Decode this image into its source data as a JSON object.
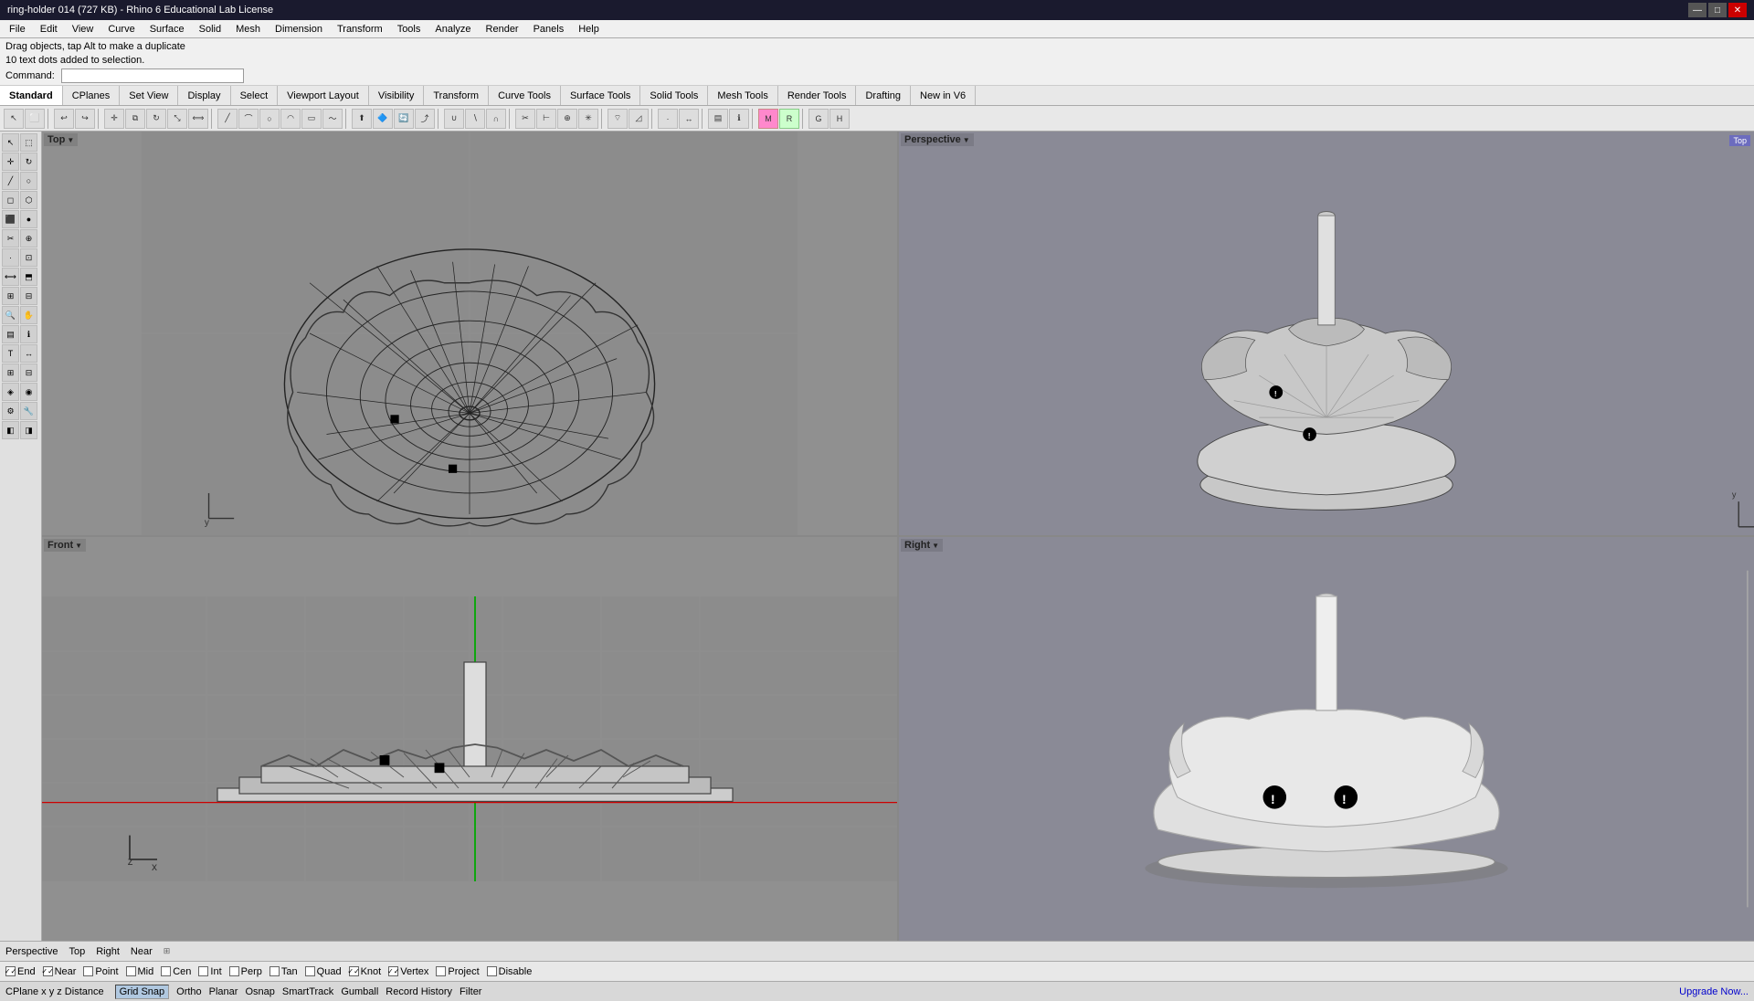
{
  "titleBar": {
    "title": "ring-holder 014 (727 KB) - Rhino 6 Educational Lab License",
    "minimize": "—",
    "maximize": "□",
    "close": "✕"
  },
  "menuBar": {
    "items": [
      "File",
      "Edit",
      "View",
      "Curve",
      "Surface",
      "Solid",
      "Mesh",
      "Dimension",
      "Transform",
      "Tools",
      "Analyze",
      "Render",
      "Panels",
      "Help"
    ]
  },
  "infoBar": {
    "line1": "Drag objects, tap Alt to make a duplicate",
    "line2": "10 text dots added to selection.",
    "commandLabel": "Command:"
  },
  "toolbarTabs": {
    "tabs": [
      "Standard",
      "CPlanes",
      "Set View",
      "Display",
      "Select",
      "Viewport Layout",
      "Visibility",
      "Transform",
      "Curve Tools",
      "Surface Tools",
      "Solid Tools",
      "Mesh Tools",
      "Render Tools",
      "Drafting",
      "New in V6"
    ]
  },
  "viewports": {
    "topLeft": {
      "label": "Top",
      "type": "orthographic"
    },
    "topRight": {
      "label": "Perspective",
      "type": "perspective",
      "badge": "Top"
    },
    "bottomLeft": {
      "label": "Front",
      "type": "orthographic"
    },
    "bottomRight": {
      "label": "Right",
      "type": "orthographic"
    }
  },
  "statusBar": {
    "labels": [
      "Perspective",
      "Top",
      "Right"
    ],
    "near": "Near"
  },
  "osnapBar": {
    "items": [
      {
        "label": "End",
        "checked": true
      },
      {
        "label": "Near",
        "checked": true
      },
      {
        "label": "Point",
        "checked": false
      },
      {
        "label": "Mid",
        "checked": false
      },
      {
        "label": "Cen",
        "checked": false
      },
      {
        "label": "Int",
        "checked": false
      },
      {
        "label": "Perp",
        "checked": false
      },
      {
        "label": "Tan",
        "checked": false
      },
      {
        "label": "Quad",
        "checked": false
      },
      {
        "label": "Knot",
        "checked": true
      },
      {
        "label": "Vertex",
        "checked": true
      },
      {
        "label": "Project",
        "checked": false
      },
      {
        "label": "Disable",
        "checked": false
      }
    ]
  },
  "coordBar": {
    "cplane": "CPlane x y z  Distance",
    "gridSnap": "Grid Snap",
    "ortho": "Ortho",
    "planar": "Planar",
    "osnap": "Osnap",
    "smarttrack": "SmartTrack",
    "gumball": "Gumball",
    "recordHistory": "Record History",
    "filter": "Filter",
    "upgradeNow": "Upgrade Now..."
  }
}
